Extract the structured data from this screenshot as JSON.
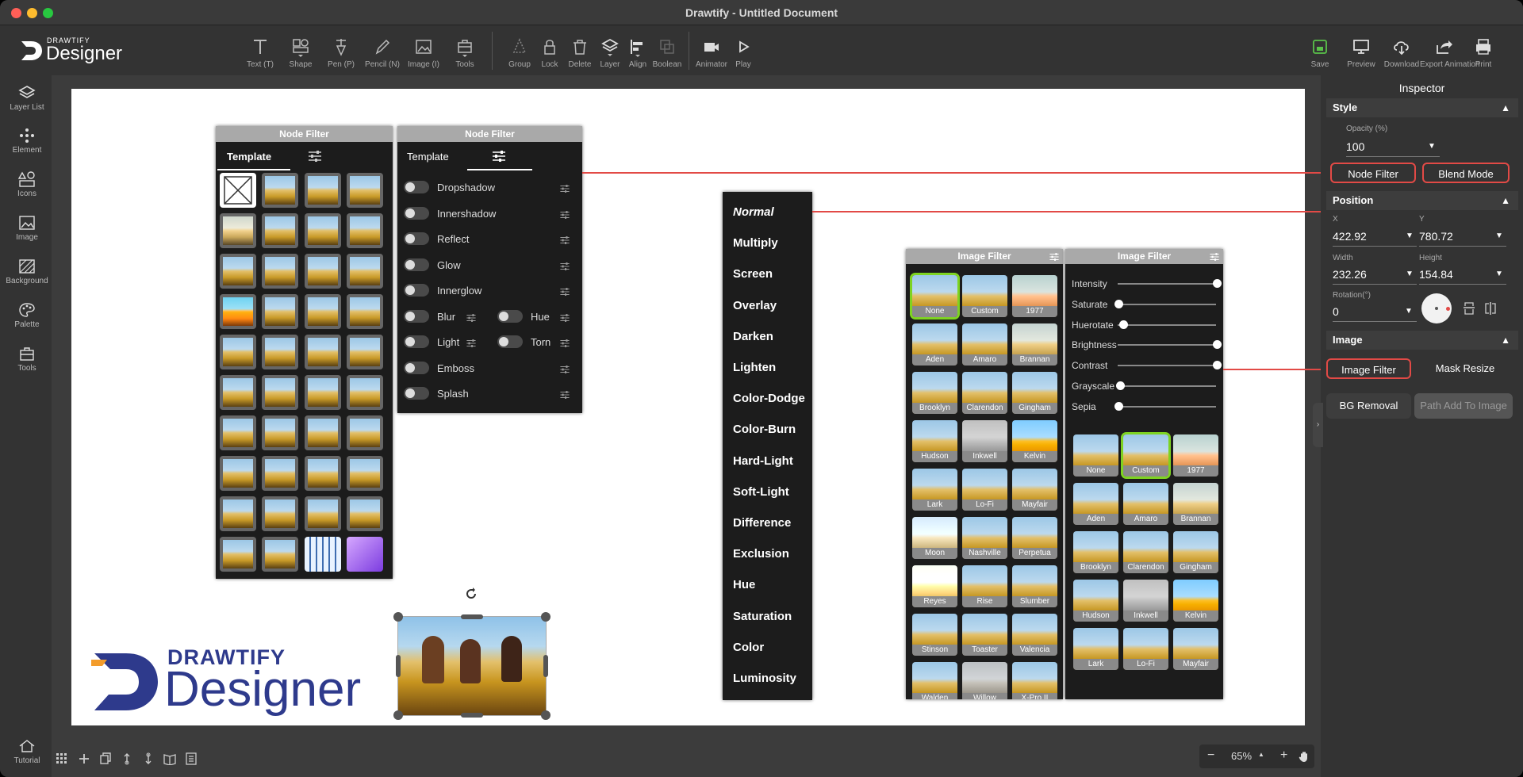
{
  "window": {
    "title": "Drawtify - Untitled Document"
  },
  "brand": {
    "small": "DRAWTIFY",
    "large": "Designer"
  },
  "toolbar": {
    "tools": [
      {
        "name": "text",
        "label": "Text (T)"
      },
      {
        "name": "shape",
        "label": "Shape"
      },
      {
        "name": "pen",
        "label": "Pen (P)"
      },
      {
        "name": "pencil",
        "label": "Pencil (N)"
      },
      {
        "name": "image",
        "label": "Image (I)"
      },
      {
        "name": "tools",
        "label": "Tools"
      },
      {
        "name": "group",
        "label": "Group"
      },
      {
        "name": "lock",
        "label": "Lock"
      },
      {
        "name": "delete",
        "label": "Delete"
      },
      {
        "name": "layer",
        "label": "Layer"
      },
      {
        "name": "align",
        "label": "Align"
      },
      {
        "name": "boolean",
        "label": "Boolean"
      },
      {
        "name": "animator",
        "label": "Animator"
      },
      {
        "name": "play",
        "label": "Play"
      }
    ],
    "right": [
      {
        "name": "save",
        "label": "Save"
      },
      {
        "name": "preview",
        "label": "Preview"
      },
      {
        "name": "download",
        "label": "Download"
      },
      {
        "name": "export-animation",
        "label": "Export Animation"
      },
      {
        "name": "print",
        "label": "Print"
      }
    ]
  },
  "sidebar": {
    "items": [
      "Layer List",
      "Element",
      "Icons",
      "Image",
      "Background",
      "Palette",
      "Tools"
    ],
    "bottom": "Tutorial"
  },
  "node_filter_template": {
    "title": "Node Filter",
    "tab_template": "Template"
  },
  "node_filter_settings": {
    "title": "Node Filter",
    "tab_template": "Template",
    "filters": [
      "Dropshadow",
      "Innershadow",
      "Reflect",
      "Glow",
      "Innerglow",
      "Blur",
      "Hue",
      "Light",
      "Torn",
      "Emboss",
      "Splash"
    ]
  },
  "blend_modes": [
    "Normal",
    "Multiply",
    "Screen",
    "Overlay",
    "Darken",
    "Lighten",
    "Color-Dodge",
    "Color-Burn",
    "Hard-Light",
    "Soft-Light",
    "Difference",
    "Exclusion",
    "Hue",
    "Saturation",
    "Color",
    "Luminosity"
  ],
  "image_filter_presets": {
    "title": "Image Filter",
    "items": [
      "None",
      "Custom",
      "1977",
      "Aden",
      "Amaro",
      "Brannan",
      "Brooklyn",
      "Clarendon",
      "Gingham",
      "Hudson",
      "Inkwell",
      "Kelvin",
      "Lark",
      "Lo-Fi",
      "Mayfair",
      "Moon",
      "Nashville",
      "Perpetua",
      "Reyes",
      "Rise",
      "Slumber",
      "Stinson",
      "Toaster",
      "Valencia",
      "Walden",
      "Willow",
      "X-Pro II"
    ],
    "selected": "None"
  },
  "image_filter_custom": {
    "title": "Image Filter",
    "sliders": [
      {
        "label": "Intensity",
        "value": 1.0
      },
      {
        "label": "Saturate",
        "value": 0.0
      },
      {
        "label": "Huerotate",
        "value": 0.05
      },
      {
        "label": "Brightness",
        "value": 1.0
      },
      {
        "label": "Contrast",
        "value": 1.0
      },
      {
        "label": "Grayscale",
        "value": 0.02
      },
      {
        "label": "Sepia",
        "value": 0.0
      }
    ],
    "presets": [
      "None",
      "Custom",
      "1977",
      "Aden",
      "Amaro",
      "Brannan",
      "Brooklyn",
      "Clarendon",
      "Gingham",
      "Hudson",
      "Inkwell",
      "Kelvin",
      "Lark",
      "Lo-Fi",
      "Mayfair"
    ],
    "selected": "Custom"
  },
  "inspector": {
    "title": "Inspector",
    "style": {
      "header": "Style",
      "opacity_label": "Opacity (%)",
      "opacity": "100",
      "node_filter": "Node Filter",
      "blend_mode": "Blend Mode"
    },
    "position": {
      "header": "Position",
      "x_label": "X",
      "x": "422.92",
      "y_label": "Y",
      "y": "780.72",
      "w_label": "Width",
      "w": "232.26",
      "h_label": "Height",
      "h": "154.84",
      "rot_label": "Rotation(°)",
      "rot": "0"
    },
    "image": {
      "header": "Image",
      "image_filter": "Image Filter",
      "mask_resize": "Mask Resize",
      "bg_removal": "BG Removal",
      "path_add": "Path Add To Image"
    }
  },
  "zoom": {
    "value": "65%"
  },
  "colors": {
    "accent_red": "#e24a46",
    "selected_green": "#7ed321",
    "brand_blue": "#2e3a8c"
  }
}
